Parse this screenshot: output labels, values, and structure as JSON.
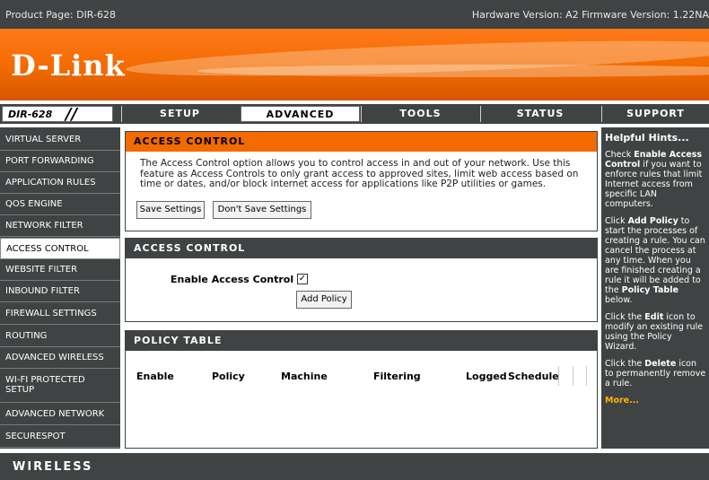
{
  "topbar": {
    "product_page": "Product Page: DIR-628",
    "versions": "Hardware Version: A2   Firmware Version: 1.22NA"
  },
  "banner": {
    "logo": "D-Link"
  },
  "nav": {
    "model": "DIR-628",
    "tabs": [
      {
        "label": "SETUP"
      },
      {
        "label": "ADVANCED"
      },
      {
        "label": "TOOLS"
      },
      {
        "label": "STATUS"
      },
      {
        "label": "SUPPORT"
      }
    ],
    "active_tab": "ADVANCED"
  },
  "sidebar": {
    "items": [
      {
        "label": "VIRTUAL SERVER"
      },
      {
        "label": "PORT FORWARDING"
      },
      {
        "label": "APPLICATION RULES"
      },
      {
        "label": "QOS ENGINE"
      },
      {
        "label": "NETWORK FILTER"
      },
      {
        "label": "ACCESS CONTROL"
      },
      {
        "label": "WEBSITE FILTER"
      },
      {
        "label": "INBOUND FILTER"
      },
      {
        "label": "FIREWALL SETTINGS"
      },
      {
        "label": "ROUTING"
      },
      {
        "label": "ADVANCED WIRELESS"
      },
      {
        "label": "WI-FI PROTECTED SETUP"
      },
      {
        "label": "ADVANCED NETWORK"
      },
      {
        "label": "SECURESPOT"
      }
    ],
    "active_item": "ACCESS CONTROL"
  },
  "main": {
    "intro": {
      "title": "ACCESS CONTROL",
      "description": "The Access Control option allows you to control access in and out of your network. Use this feature as Access Controls to only grant access to approved sites, limit web access based on time or dates, and/or block internet access for applications like P2P utilities or games.",
      "save_label": "Save Settings",
      "dont_save_label": "Don't Save Settings"
    },
    "access_control": {
      "title": "ACCESS CONTROL",
      "enable_label": "Enable Access Control :",
      "enable_checked": true,
      "add_policy_label": "Add Policy"
    },
    "policy_table": {
      "title": "POLICY TABLE",
      "columns": [
        "Enable",
        "Policy",
        "Machine",
        "Filtering",
        "Logged",
        "Schedule"
      ]
    }
  },
  "hints": {
    "title": "Helpful Hints...",
    "p1_a": "Check ",
    "p1_b": "Enable Access Control",
    "p1_c": " if you want to enforce rules that limit Internet access from specific LAN computers.",
    "p2_a": "Click ",
    "p2_b": "Add Policy",
    "p2_c": " to start the processes of creating a rule. You can cancel the process at any time. When you are finished creating a rule it will be added to the ",
    "p2_d": "Policy Table",
    "p2_e": " below.",
    "p3_a": "Click the ",
    "p3_b": "Edit",
    "p3_c": " icon to modify an existing rule using the Policy Wizard.",
    "p4_a": "Click the ",
    "p4_b": "Delete",
    "p4_c": " icon to permanently remove a rule.",
    "more": "More..."
  },
  "footer": {
    "label": "WIRELESS"
  },
  "colors": {
    "dark": "#404343",
    "orange": "#f26a00",
    "more_link": "#ffb300"
  }
}
